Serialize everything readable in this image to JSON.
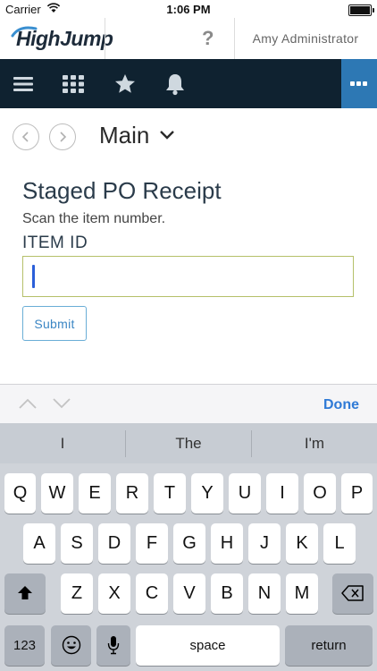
{
  "status_bar": {
    "carrier": "Carrier",
    "time": "1:06 PM"
  },
  "header": {
    "logo_text": "HighJump",
    "help_label": "?",
    "user_name": "Amy Administrator"
  },
  "nav": {
    "icons": [
      "hamburger-menu-icon",
      "apps-grid-icon",
      "favorites-star-icon",
      "notifications-bell-icon",
      "more-options-icon"
    ],
    "more_color": "#2d78b4",
    "bar_color": "#0f2230"
  },
  "subheader": {
    "menu_title": "Main"
  },
  "form": {
    "title": "Staged PO Receipt",
    "instruction": "Scan the item number.",
    "field_label": "ITEM ID",
    "field_value": "",
    "submit_label": "Submit"
  },
  "keyboard": {
    "done_label": "Done",
    "suggestions": [
      "I",
      "The",
      "I'm"
    ],
    "row1": [
      "Q",
      "W",
      "E",
      "R",
      "T",
      "Y",
      "U",
      "I",
      "O",
      "P"
    ],
    "row2": [
      "A",
      "S",
      "D",
      "F",
      "G",
      "H",
      "J",
      "K",
      "L"
    ],
    "row3": [
      "Z",
      "X",
      "C",
      "V",
      "B",
      "N",
      "M"
    ],
    "numbers_label": "123",
    "space_label": "space",
    "return_label": "return"
  }
}
